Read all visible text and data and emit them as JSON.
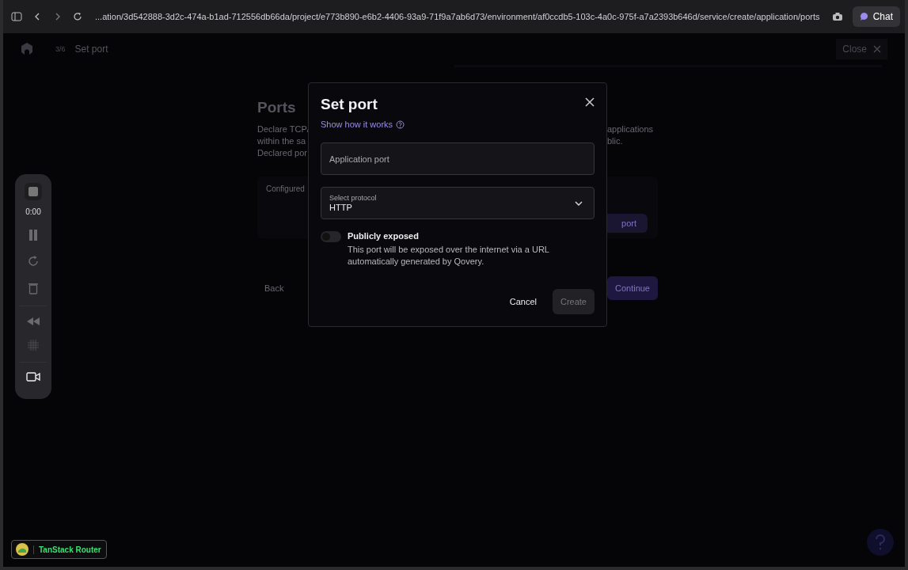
{
  "browser": {
    "url": "...ation/3d542888-3d2c-474a-b1ad-712556db66da/project/e773b890-e6b2-4406-93a9-71f9a7ab6d73/environment/af0ccdb5-103c-4a0c-975f-a7a2393b646d/service/create/application/ports",
    "chat_button": "Chat"
  },
  "header": {
    "step": "3/6",
    "title": "Set port",
    "close": "Close"
  },
  "page": {
    "title": "Ports",
    "description_left": [
      "Declare TCP/",
      "within the sa",
      "Declared por"
    ],
    "description_right": [
      "applications",
      "blic."
    ],
    "card_label": "Configured",
    "card_button": "port",
    "back": "Back",
    "continue": "Continue"
  },
  "recorder": {
    "time": "0:00"
  },
  "modal": {
    "title": "Set port",
    "help_link": "Show how it works",
    "port_field": {
      "placeholder": "Application port"
    },
    "protocol": {
      "label": "Select protocol",
      "value": "HTTP"
    },
    "public_toggle": {
      "on": false,
      "label": "Publicly exposed",
      "description": "This port will be exposed over the internet via a URL automatically generated by Qovery."
    },
    "buttons": [
      {
        "label": "Cancel",
        "kind": "text",
        "disabled": false
      },
      {
        "label": "Create",
        "kind": "filled",
        "disabled": true
      }
    ]
  },
  "devtools": {
    "label": "TanStack Router"
  }
}
